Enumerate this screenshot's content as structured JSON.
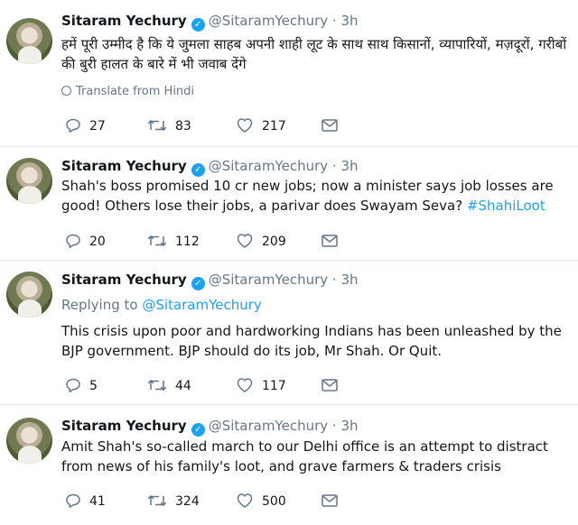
{
  "tweets": [
    {
      "name": "Sitaram Yechury",
      "handle": "@SitaramYechury",
      "dot": "·",
      "time": "3h",
      "text": "हमें पूरी उम्मीद है कि ये जुमला साहब अपनी शाही लूट के साथ साथ किसानों, व्यापारियों, मज़दूरों, गरीबों की बुरी हालत के बारे में भी जवाब देंगे",
      "translate": "Translate from Hindi",
      "replies": "27",
      "retweets": "83",
      "likes": "217"
    },
    {
      "name": "Sitaram Yechury",
      "handle": "@SitaramYechury",
      "dot": "·",
      "time": "3h",
      "text": "Shah's boss promised 10 cr new jobs; now a minister says job losses are good! Others lose their jobs, a parivar does Swayam Seva? ",
      "hashtag": "#ShahiLoot",
      "replies": "20",
      "retweets": "112",
      "likes": "209"
    },
    {
      "name": "Sitaram Yechury",
      "handle": "@SitaramYechury",
      "dot": "·",
      "time": "3h",
      "replying_label": "Replying to ",
      "replying_to": "@SitaramYechury",
      "text": "This crisis upon poor and hardworking Indians has been unleashed by the BJP government. BJP should do its job, Mr Shah. Or Quit.",
      "replies": "5",
      "retweets": "44",
      "likes": "117"
    },
    {
      "name": "Sitaram Yechury",
      "handle": "@SitaramYechury",
      "dot": "·",
      "time": "3h",
      "text": "Amit Shah's so-called march to our Delhi office is an attempt to distract from news of his family's loot, and grave farmers & traders crisis",
      "replies": "41",
      "retweets": "324",
      "likes": "500"
    }
  ],
  "icons": {
    "verified": "verified-badge-icon",
    "reply": "reply-icon",
    "retweet": "retweet-icon",
    "like": "heart-icon",
    "dm": "envelope-icon",
    "translate": "globe-icon"
  },
  "colors": {
    "link": "#1da1f2",
    "secondary": "#657786",
    "divider": "#e6ecf0"
  }
}
